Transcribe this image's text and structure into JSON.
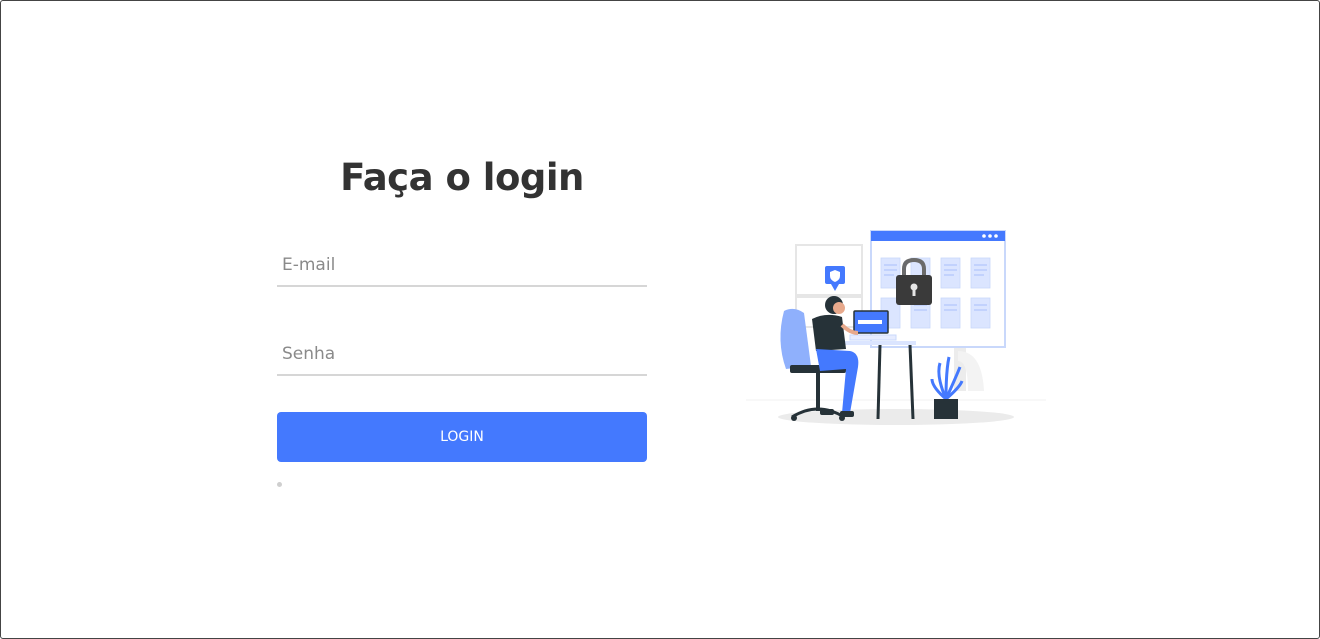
{
  "login": {
    "title": "Faça o login",
    "email": {
      "placeholder": "E-mail",
      "value": ""
    },
    "password": {
      "placeholder": "Senha",
      "value": ""
    },
    "submit_label": "LOGIN"
  },
  "illustration": {
    "name": "secure-login-illustration",
    "icons": [
      "shield-icon",
      "padlock-icon",
      "document-icon",
      "plant-icon",
      "laptop-icon"
    ]
  },
  "colors": {
    "accent": "#4479fe",
    "title_text": "#333333",
    "placeholder": "#8a8a8a",
    "underline": "#d6d6d6",
    "illustration_light": "#dbe5ff",
    "illustration_dark": "#263238"
  }
}
